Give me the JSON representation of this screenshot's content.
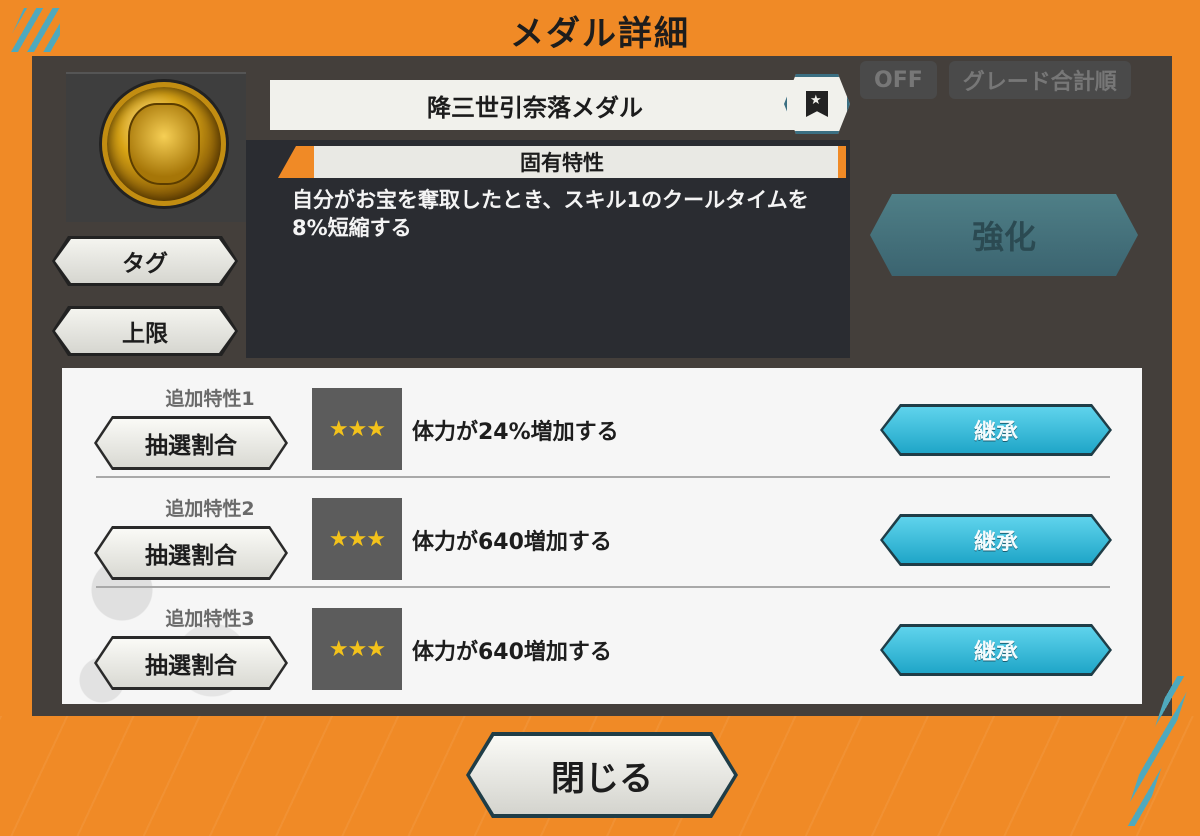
{
  "modal": {
    "title": "メダル詳細",
    "medal_name": "降三世引奈落メダル",
    "unique_trait_header": "固有特性",
    "unique_trait_desc": "自分がお宝を奪取したとき、スキル1のクールタイムを8%短縮する",
    "tag_button": "タグ",
    "limit_button": "上限",
    "enhance_button": "強化",
    "close_button": "閉じる"
  },
  "background": {
    "off_label": "OFF",
    "sort_label": "グレード合計順"
  },
  "additional_traits": [
    {
      "label": "追加特性1",
      "lottery_button": "抽選割合",
      "stars": "★★★",
      "star_count": 3,
      "effect": "体力が24%増加する",
      "inherit_button": "継承"
    },
    {
      "label": "追加特性2",
      "lottery_button": "抽選割合",
      "stars": "★★★",
      "star_count": 3,
      "effect": "体力が640増加する",
      "inherit_button": "継承"
    },
    {
      "label": "追加特性3",
      "lottery_button": "抽選割合",
      "stars": "★★★",
      "star_count": 3,
      "effect": "体力が640増加する",
      "inherit_button": "継承"
    }
  ],
  "icons": {
    "medal": "gold-medal-icon",
    "bookmark": "bookmark-star-icon",
    "star": "star-icon"
  },
  "colors": {
    "frame_orange": "#f08a26",
    "inherit_cyan": "#1fa6c8",
    "star_gold": "#f3c21b",
    "enhance_disabled": "#3b6470"
  }
}
